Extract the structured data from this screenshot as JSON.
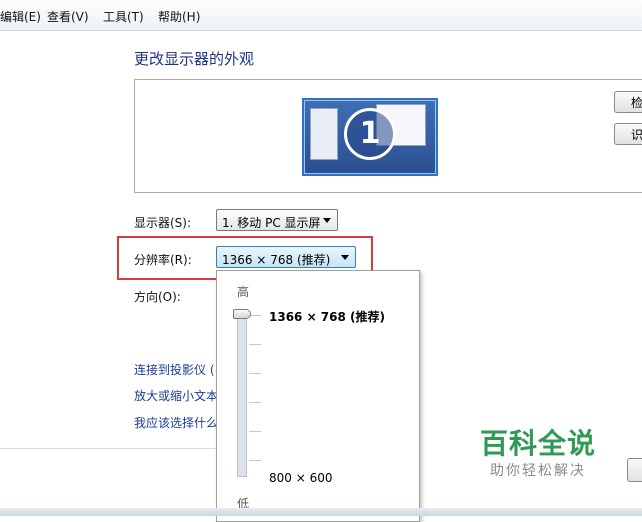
{
  "menu": [
    "编辑(E)",
    "查看(V)",
    "工具(T)",
    "帮助(H)"
  ],
  "page": {
    "title": "更改显示器的外观"
  },
  "preview": {
    "monitor_number": "1",
    "side_buttons": [
      "检",
      "识"
    ]
  },
  "display": {
    "label": "显示器(S):",
    "value": "1. 移动 PC 显示屏"
  },
  "resolution": {
    "label": "分辨率(R):",
    "value": "1366 × 768 (推荐)",
    "dropdown": {
      "high_label": "高",
      "low_label": "低",
      "top_option": "1366 × 768 (推荐)",
      "bottom_option": "800 × 600",
      "slider_position": 1.0
    }
  },
  "orientation": {
    "label": "方向(O):"
  },
  "links": [
    "连接到投影仪 (",
    "放大或缩小文本",
    "我应该选择什么"
  ],
  "watermark": {
    "title": "百科全说",
    "subtitle": "助你轻松解决"
  },
  "colors": {
    "link": "#1a3d93",
    "title": "#1e3287",
    "highlight_box": "#d63c3c",
    "watermark": "#2f9a53"
  }
}
